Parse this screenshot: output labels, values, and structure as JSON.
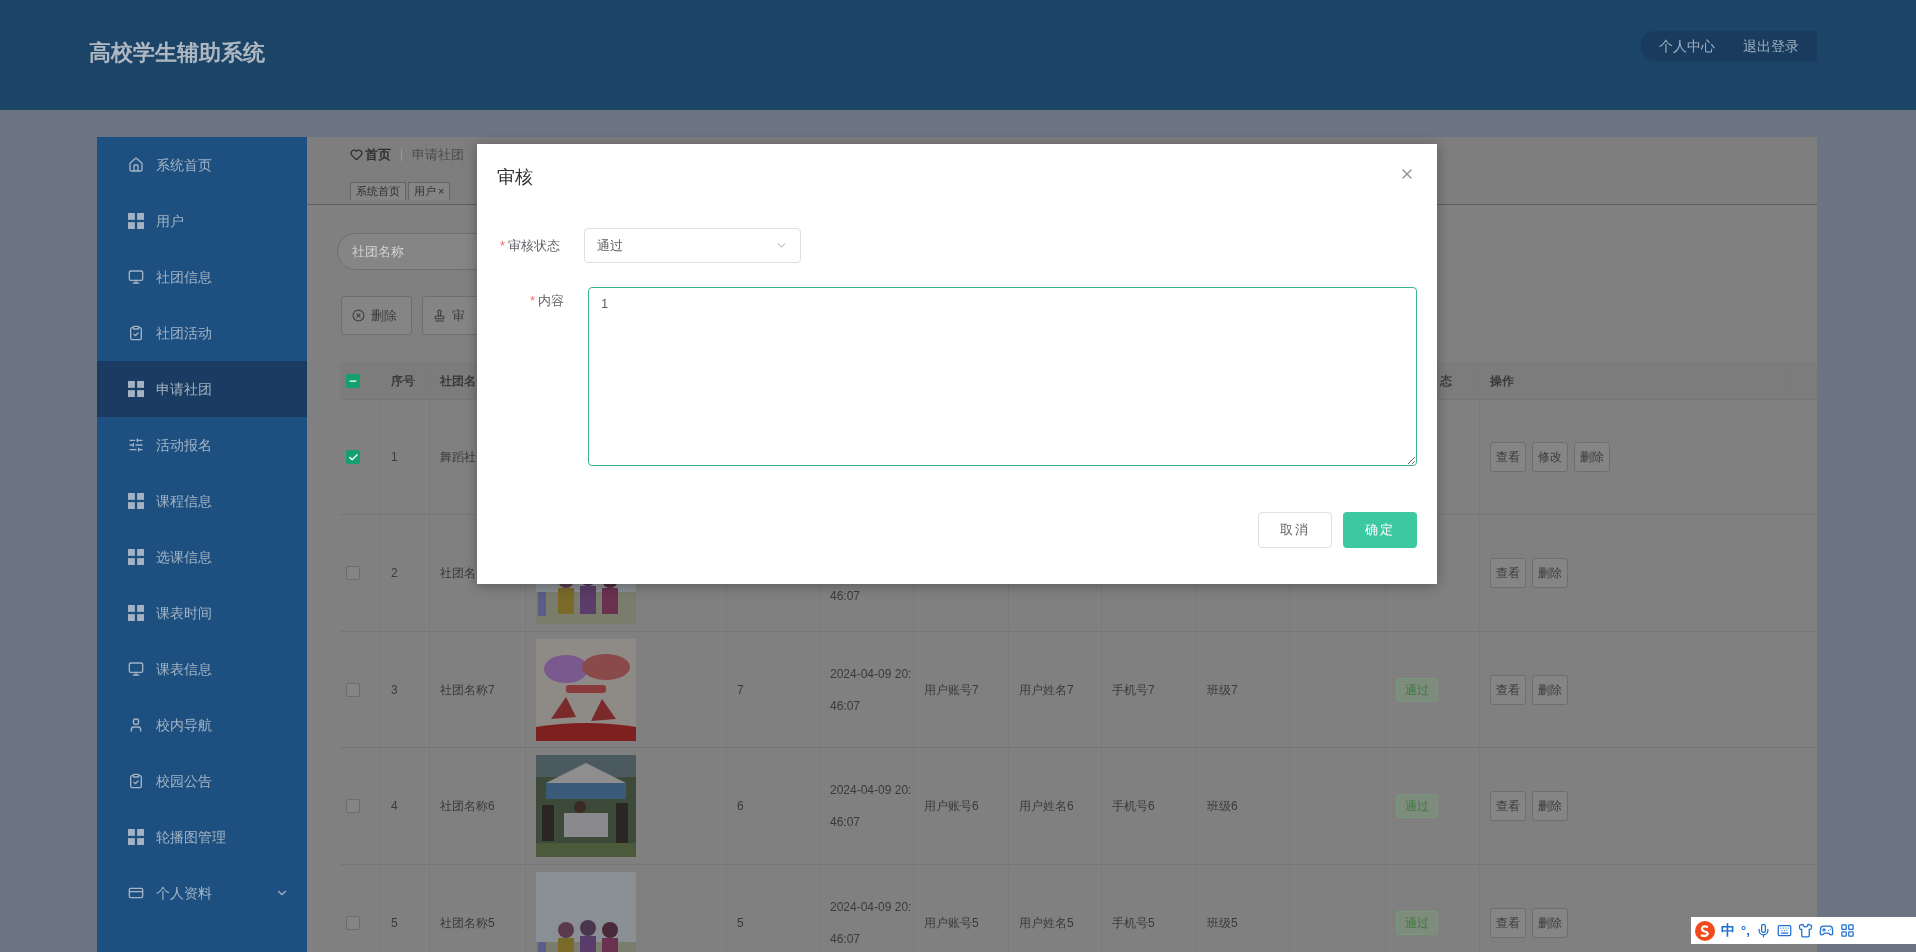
{
  "header": {
    "title": "高校学生辅助系统",
    "links": [
      {
        "label": "个人中心"
      },
      {
        "label": "退出登录"
      }
    ]
  },
  "sidebar": {
    "items": [
      {
        "label": "系统首页",
        "selected": false,
        "kind": "link"
      },
      {
        "label": "用户",
        "selected": false,
        "kind": "link"
      },
      {
        "label": "社团信息",
        "selected": false,
        "kind": "link"
      },
      {
        "label": "社团活动",
        "selected": false,
        "kind": "link"
      },
      {
        "label": "申请社团",
        "selected": true,
        "kind": "link"
      },
      {
        "label": "活动报名",
        "selected": false,
        "kind": "link"
      },
      {
        "label": "课程信息",
        "selected": false,
        "kind": "link"
      },
      {
        "label": "选课信息",
        "selected": false,
        "kind": "link"
      },
      {
        "label": "课表时间",
        "selected": false,
        "kind": "link"
      },
      {
        "label": "课表信息",
        "selected": false,
        "kind": "link"
      },
      {
        "label": "校内导航",
        "selected": false,
        "kind": "link"
      },
      {
        "label": "校园公告",
        "selected": false,
        "kind": "link"
      },
      {
        "label": "轮播图管理",
        "selected": false,
        "kind": "link"
      },
      {
        "label": "个人资料",
        "selected": false,
        "kind": "group"
      }
    ]
  },
  "breadcrumb": {
    "home": "首页",
    "current": "申请社团"
  },
  "tabs": [
    {
      "label": "系统首页"
    },
    {
      "label": "用户",
      "close": "×"
    }
  ],
  "search": {
    "placeholder": "社团名称"
  },
  "toolbar": [
    {
      "label": "删除",
      "kind": "delete"
    },
    {
      "label": "审",
      "kind": "review"
    }
  ],
  "table": {
    "select_all": {
      "indeterminate": true
    },
    "columns": [
      {
        "label": "序号"
      },
      {
        "label": "社团名"
      },
      {
        "label": "态"
      },
      {
        "label": "操作"
      }
    ],
    "rows": [
      {
        "checked": true,
        "index": "1",
        "name": "舞蹈社",
        "actions": [
          {
            "label": "查看"
          },
          {
            "label": "修改"
          },
          {
            "label": "删除"
          }
        ]
      },
      {
        "checked": false,
        "index": "2",
        "name": "社团名",
        "image": {
          "kind": "picture"
        },
        "time": "46:07",
        "actions": [
          {
            "label": "查看"
          },
          {
            "label": "删除"
          }
        ]
      },
      {
        "checked": false,
        "index": "3",
        "name": "社团名称7",
        "image": {
          "kind": "picture"
        },
        "column_5": "7",
        "date": "2024-04-09 20:",
        "time": "46:07",
        "account": "用户账号7",
        "user_name": "用户姓名7",
        "phone": "手机号7",
        "class": "班级7",
        "status": "通过",
        "actions": [
          {
            "label": "查看"
          },
          {
            "label": "删除"
          }
        ]
      },
      {
        "checked": false,
        "index": "4",
        "name": "社团名称6",
        "image": {
          "kind": "picture"
        },
        "column_5": "6",
        "date": "2024-04-09 20:",
        "time": "46:07",
        "account": "用户账号6",
        "user_name": "用户姓名6",
        "phone": "手机号6",
        "class": "班级6",
        "status": "通过",
        "actions": [
          {
            "label": "查看"
          },
          {
            "label": "删除"
          }
        ]
      },
      {
        "checked": false,
        "index": "5",
        "name": "社团名称5",
        "image": {
          "kind": "picture"
        },
        "column_5": "5",
        "date": "2024-04-09 20:",
        "time": "46:07",
        "account": "用户账号5",
        "user_name": "用户姓名5",
        "phone": "手机号5",
        "class": "班级5",
        "status": "通过",
        "actions": [
          {
            "label": "查看"
          },
          {
            "label": "删除"
          }
        ]
      }
    ]
  },
  "dialog": {
    "title": "审核",
    "fields": [
      {
        "kind": "select",
        "required_mark": "*",
        "label": "审核状态",
        "value": "通过"
      },
      {
        "kind": "textarea",
        "required_mark": "*",
        "label": "内容",
        "value": "1"
      }
    ],
    "buttons": [
      {
        "label": "取消",
        "kind": "secondary"
      },
      {
        "label": "确定",
        "kind": "primary"
      }
    ]
  },
  "ime_bar": {
    "mode": "中",
    "punctuation": "°,"
  }
}
